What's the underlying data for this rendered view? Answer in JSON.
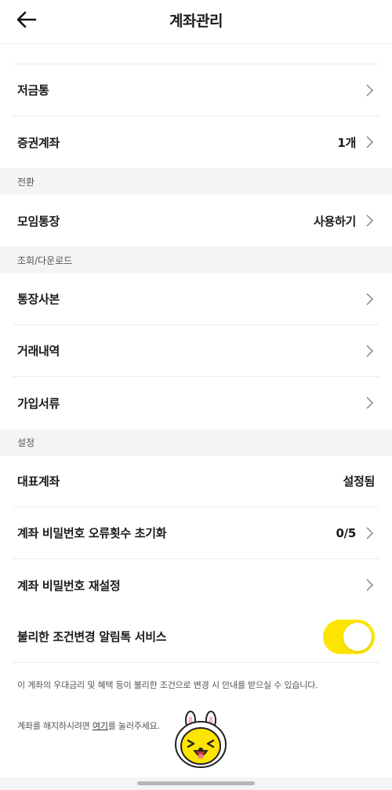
{
  "header": {
    "title": "계좌관리"
  },
  "rows_top": [
    {
      "label": "저금통",
      "value": "",
      "chevron": true
    },
    {
      "label": "증권계좌",
      "value": "1개",
      "chevron": true
    }
  ],
  "section_switch": {
    "title": "전환",
    "rows": [
      {
        "label": "모임통장",
        "value": "사용하기",
        "chevron": true
      }
    ]
  },
  "section_view": {
    "title": "조회/다운로드",
    "rows": [
      {
        "label": "통장사본",
        "chevron": true
      },
      {
        "label": "거래내역",
        "chevron": true
      },
      {
        "label": "가입서류",
        "chevron": true
      }
    ]
  },
  "section_settings": {
    "title": "설정",
    "rows": [
      {
        "label": "대표계좌",
        "value": "설정됨",
        "chevron": false
      },
      {
        "label": "계좌 비밀번호 오류횟수 초기화",
        "value": "0/5",
        "chevron": true
      },
      {
        "label": "계좌 비밀번호 재설정",
        "value": "",
        "chevron": true
      }
    ],
    "toggle_row": {
      "label": "불리한 조건변경 알림톡 서비스",
      "enabled": true
    }
  },
  "notice": "이 계좌의 우대금리 및 혜택 등이 불리한 조건으로 변경 시 안내를 받으실 수 있습니다.",
  "close_account": {
    "before": "계좌를 해지하시려면 ",
    "link": "여기",
    "after": "를 눌러주세요."
  },
  "colors": {
    "accent": "#fee500",
    "section_bg": "#f4f4f4",
    "divider": "#ececec"
  },
  "icons": {
    "back": "arrow-left-icon",
    "chevron": "chevron-right-icon",
    "mascot": "kakao-character"
  }
}
